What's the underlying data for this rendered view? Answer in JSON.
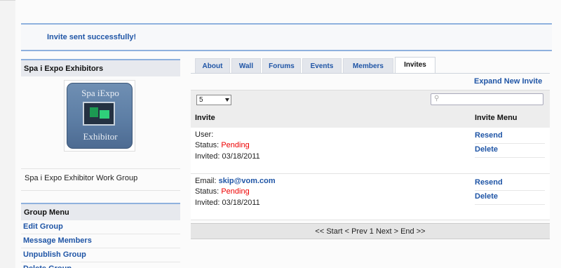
{
  "banner": {
    "message": "Invite sent successfully!"
  },
  "sidebar": {
    "group_title": "Spa i Expo Exhibitors",
    "logo": {
      "top_text": "Spa iExpo",
      "bottom_text": "Exhibitor"
    },
    "group_description": "Spa i Expo Exhibitor Work Group",
    "menu_title": "Group Menu",
    "menu_items": [
      "Edit Group",
      "Message Members",
      "Unpublish Group",
      "Delete Group"
    ]
  },
  "tabs": [
    {
      "label": "About"
    },
    {
      "label": "Wall"
    },
    {
      "label": "Forums"
    },
    {
      "label": "Events"
    },
    {
      "label": "Members"
    },
    {
      "label": "Invites",
      "active": true
    }
  ],
  "invites": {
    "expand_link": "Expand New Invite",
    "per_page_value": "5",
    "search_placeholder": "",
    "col_invite": "Invite",
    "col_menu": "Invite Menu",
    "rows": [
      {
        "line1_label": "User:",
        "line1_value": "",
        "status_label": "Status:",
        "status_value": "Pending",
        "invited_text": "Invited: 03/18/2011",
        "actions": [
          "Resend",
          "Delete"
        ]
      },
      {
        "line1_label": "Email:",
        "line1_value": "skip@vom.com",
        "status_label": "Status:",
        "status_value": "Pending",
        "invited_text": "Invited: 03/18/2011",
        "actions": [
          "Resend",
          "Delete"
        ]
      }
    ],
    "pager": "<< Start < Prev 1 Next > End >>"
  },
  "colors": {
    "link": "#1f55a6",
    "pending": "#e00000",
    "accent_border": "#8fb1de"
  }
}
